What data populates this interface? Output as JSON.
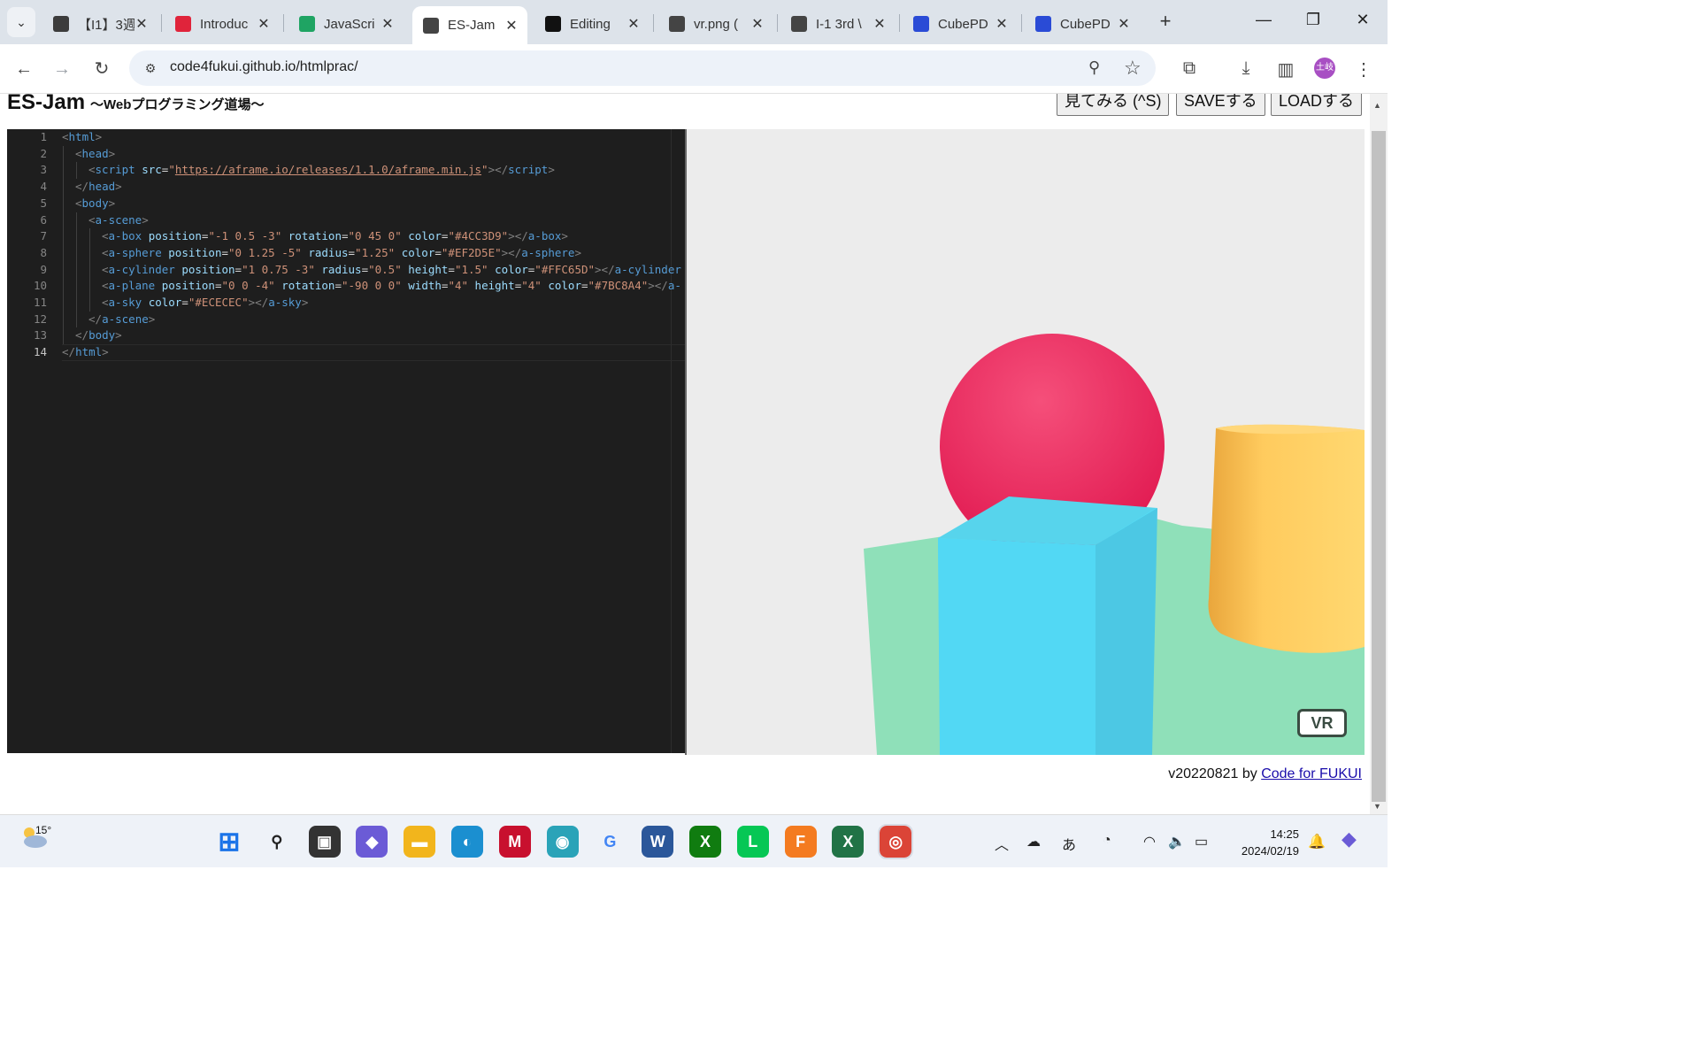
{
  "browser": {
    "tabs": [
      {
        "title": "【I1】3週",
        "icon": "classroom-icon",
        "color": "#3c3c3c"
      },
      {
        "title": "Introduc",
        "icon": "adobe-icon",
        "color": "#e0243b"
      },
      {
        "title": "JavaScri",
        "icon": "drive-icon",
        "color": "#1fa463"
      },
      {
        "title": "ES-Jam",
        "icon": "globe-icon",
        "color": "#444"
      },
      {
        "title": "Editing",
        "icon": "github-icon",
        "color": "#111"
      },
      {
        "title": "vr.png (",
        "icon": "globe-icon",
        "color": "#444"
      },
      {
        "title": "I-1 3rd \\",
        "icon": "globe-icon",
        "color": "#444"
      },
      {
        "title": "CubePD",
        "icon": "cubepdf-icon",
        "color": "#2a4bd6"
      },
      {
        "title": "CubePD",
        "icon": "cubepdf-icon",
        "color": "#2a4bd6"
      }
    ],
    "active_tab_index": 3,
    "url": "code4fukui.github.io/htmlprac/",
    "avatar_text": "土岐",
    "new_tab_symbol": "+"
  },
  "page": {
    "title": "ES-Jam",
    "subtitle": "～Webプログラミング道場～",
    "buttons": {
      "view": "見てみる (^S)",
      "save": "SAVEする",
      "load": "LOADする"
    },
    "footer_version": "v20220821 by ",
    "footer_link": "Code for FUKUI"
  },
  "editor": {
    "current_line": 14,
    "lines": [
      {
        "n": "1",
        "indent": 0,
        "tokens": [
          [
            "p",
            "<"
          ],
          [
            "t",
            "html"
          ],
          [
            "p",
            ">"
          ]
        ]
      },
      {
        "n": "2",
        "indent": 1,
        "tokens": [
          [
            "p",
            "<"
          ],
          [
            "t",
            "head"
          ],
          [
            "p",
            ">"
          ]
        ]
      },
      {
        "n": "3",
        "indent": 2,
        "tokens": [
          [
            "p",
            "<"
          ],
          [
            "t",
            "script"
          ],
          [
            "w",
            " "
          ],
          [
            "a",
            "src"
          ],
          [
            "w",
            "="
          ],
          [
            "v",
            "\""
          ],
          [
            "u",
            "https://aframe.io/releases/1.1.0/aframe.min.js"
          ],
          [
            "v",
            "\""
          ],
          [
            "p",
            "></"
          ],
          [
            "t",
            "script"
          ],
          [
            "p",
            ">"
          ]
        ]
      },
      {
        "n": "4",
        "indent": 1,
        "tokens": [
          [
            "p",
            "</"
          ],
          [
            "t",
            "head"
          ],
          [
            "p",
            ">"
          ]
        ]
      },
      {
        "n": "5",
        "indent": 1,
        "tokens": [
          [
            "p",
            "<"
          ],
          [
            "t",
            "body"
          ],
          [
            "p",
            ">"
          ]
        ]
      },
      {
        "n": "6",
        "indent": 2,
        "tokens": [
          [
            "p",
            "<"
          ],
          [
            "t",
            "a-scene"
          ],
          [
            "p",
            ">"
          ]
        ]
      },
      {
        "n": "7",
        "indent": 3,
        "tokens": [
          [
            "p",
            "<"
          ],
          [
            "t",
            "a-box"
          ],
          [
            "w",
            " "
          ],
          [
            "a",
            "position"
          ],
          [
            "w",
            "="
          ],
          [
            "v",
            "\"-1 0.5 -3\""
          ],
          [
            "w",
            " "
          ],
          [
            "a",
            "rotation"
          ],
          [
            "w",
            "="
          ],
          [
            "v",
            "\"0 45 0\""
          ],
          [
            "w",
            " "
          ],
          [
            "a",
            "color"
          ],
          [
            "w",
            "="
          ],
          [
            "v",
            "\"#4CC3D9\""
          ],
          [
            "p",
            "></"
          ],
          [
            "t",
            "a-box"
          ],
          [
            "p",
            ">"
          ]
        ]
      },
      {
        "n": "8",
        "indent": 3,
        "tokens": [
          [
            "p",
            "<"
          ],
          [
            "t",
            "a-sphere"
          ],
          [
            "w",
            " "
          ],
          [
            "a",
            "position"
          ],
          [
            "w",
            "="
          ],
          [
            "v",
            "\"0 1.25 -5\""
          ],
          [
            "w",
            " "
          ],
          [
            "a",
            "radius"
          ],
          [
            "w",
            "="
          ],
          [
            "v",
            "\"1.25\""
          ],
          [
            "w",
            " "
          ],
          [
            "a",
            "color"
          ],
          [
            "w",
            "="
          ],
          [
            "v",
            "\"#EF2D5E\""
          ],
          [
            "p",
            "></"
          ],
          [
            "t",
            "a-sphere"
          ],
          [
            "p",
            ">"
          ]
        ]
      },
      {
        "n": "9",
        "indent": 3,
        "tokens": [
          [
            "p",
            "<"
          ],
          [
            "t",
            "a-cylinder"
          ],
          [
            "w",
            " "
          ],
          [
            "a",
            "position"
          ],
          [
            "w",
            "="
          ],
          [
            "v",
            "\"1 0.75 -3\""
          ],
          [
            "w",
            " "
          ],
          [
            "a",
            "radius"
          ],
          [
            "w",
            "="
          ],
          [
            "v",
            "\"0.5\""
          ],
          [
            "w",
            " "
          ],
          [
            "a",
            "height"
          ],
          [
            "w",
            "="
          ],
          [
            "v",
            "\"1.5\""
          ],
          [
            "w",
            " "
          ],
          [
            "a",
            "color"
          ],
          [
            "w",
            "="
          ],
          [
            "v",
            "\"#FFC65D\""
          ],
          [
            "p",
            "></"
          ],
          [
            "t",
            "a-cylinder"
          ]
        ]
      },
      {
        "n": "10",
        "indent": 3,
        "tokens": [
          [
            "p",
            "<"
          ],
          [
            "t",
            "a-plane"
          ],
          [
            "w",
            " "
          ],
          [
            "a",
            "position"
          ],
          [
            "w",
            "="
          ],
          [
            "v",
            "\"0 0 -4\""
          ],
          [
            "w",
            " "
          ],
          [
            "a",
            "rotation"
          ],
          [
            "w",
            "="
          ],
          [
            "v",
            "\"-90 0 0\""
          ],
          [
            "w",
            " "
          ],
          [
            "a",
            "width"
          ],
          [
            "w",
            "="
          ],
          [
            "v",
            "\"4\""
          ],
          [
            "w",
            " "
          ],
          [
            "a",
            "height"
          ],
          [
            "w",
            "="
          ],
          [
            "v",
            "\"4\""
          ],
          [
            "w",
            " "
          ],
          [
            "a",
            "color"
          ],
          [
            "w",
            "="
          ],
          [
            "v",
            "\"#7BC8A4\""
          ],
          [
            "p",
            "></"
          ],
          [
            "t",
            "a-"
          ]
        ]
      },
      {
        "n": "11",
        "indent": 3,
        "tokens": [
          [
            "p",
            "<"
          ],
          [
            "t",
            "a-sky"
          ],
          [
            "w",
            " "
          ],
          [
            "a",
            "color"
          ],
          [
            "w",
            "="
          ],
          [
            "v",
            "\"#ECECEC\""
          ],
          [
            "p",
            "></"
          ],
          [
            "t",
            "a-sky"
          ],
          [
            "p",
            ">"
          ]
        ]
      },
      {
        "n": "12",
        "indent": 2,
        "tokens": [
          [
            "p",
            "</"
          ],
          [
            "t",
            "a-scene"
          ],
          [
            "p",
            ">"
          ]
        ]
      },
      {
        "n": "13",
        "indent": 1,
        "tokens": [
          [
            "p",
            "</"
          ],
          [
            "t",
            "body"
          ],
          [
            "p",
            ">"
          ]
        ]
      },
      {
        "n": "14",
        "indent": 0,
        "tokens": [
          [
            "p",
            "</"
          ],
          [
            "t",
            "html"
          ],
          [
            "p",
            ">"
          ]
        ]
      }
    ]
  },
  "preview": {
    "vr_label": "VR",
    "colors": {
      "sky": "#ECECEC",
      "box": "#4CC3D9",
      "sphere": "#EF2D5E",
      "cylinder": "#FFC65D",
      "plane": "#7BC8A4"
    }
  },
  "taskbar": {
    "weather_temp": "15°",
    "time": "14:25",
    "date": "2024/02/19",
    "ime": "あ",
    "apps": [
      {
        "name": "start-icon",
        "color": "#1a73e8"
      },
      {
        "name": "search-icon",
        "color": "#222"
      },
      {
        "name": "task-view-icon",
        "color": "#333"
      },
      {
        "name": "copilot-icon",
        "color": "#6b5bd6"
      },
      {
        "name": "file-explorer-icon",
        "color": "#f2b51c"
      },
      {
        "name": "edge-icon",
        "color": "#1b8fd0"
      },
      {
        "name": "mcafee-icon",
        "color": "#c8102e"
      },
      {
        "name": "remote-icon",
        "color": "#2aa3b8"
      },
      {
        "name": "google-icon",
        "color": "#4285f4"
      },
      {
        "name": "word-icon",
        "color": "#2b579a"
      },
      {
        "name": "xbox-icon",
        "color": "#107c10"
      },
      {
        "name": "line-icon",
        "color": "#06c755"
      },
      {
        "name": "fusion-icon",
        "color": "#f47b20"
      },
      {
        "name": "excel-icon",
        "color": "#217346"
      },
      {
        "name": "chrome-icon",
        "color": "#db4437"
      }
    ]
  }
}
